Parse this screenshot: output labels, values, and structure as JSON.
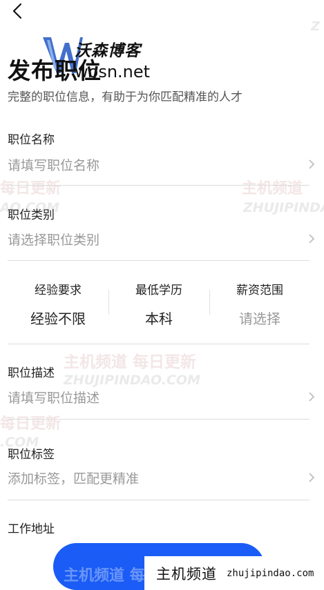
{
  "header": {
    "back_icon": "chevron-left-icon"
  },
  "logo": {
    "mark": "W",
    "title": "沃森博客",
    "url": "wosn.net"
  },
  "page": {
    "title": "发布职位",
    "subtitle": "完整的职位信息，有助于为你匹配精准的人才"
  },
  "fields": [
    {
      "label": "职位名称",
      "placeholder": "请填写职位名称"
    },
    {
      "label": "职位类别",
      "placeholder": "请选择职位类别"
    },
    {
      "label": "职位描述",
      "placeholder": "请填写职位描述"
    },
    {
      "label": "职位标签",
      "placeholder": "添加标签，匹配更精准"
    }
  ],
  "requirements": [
    {
      "label": "经验要求",
      "value": "经验不限"
    },
    {
      "label": "最低学历",
      "value": "本科"
    },
    {
      "label": "薪资范围",
      "value": "请选择"
    }
  ],
  "address": {
    "label": "工作地址"
  },
  "watermark": {
    "cn_full": "主机频道 每日更新",
    "cn_daily": "每日更新",
    "cn_channel": "主机频道",
    "en": "ZHUJIPINDAO.COM",
    "badge_cn": "主机频道",
    "badge_url": "zhujipindao.com"
  },
  "colors": {
    "accent": "#1a5cf5",
    "placeholder": "#999999",
    "divider": "#dcdcdc"
  }
}
